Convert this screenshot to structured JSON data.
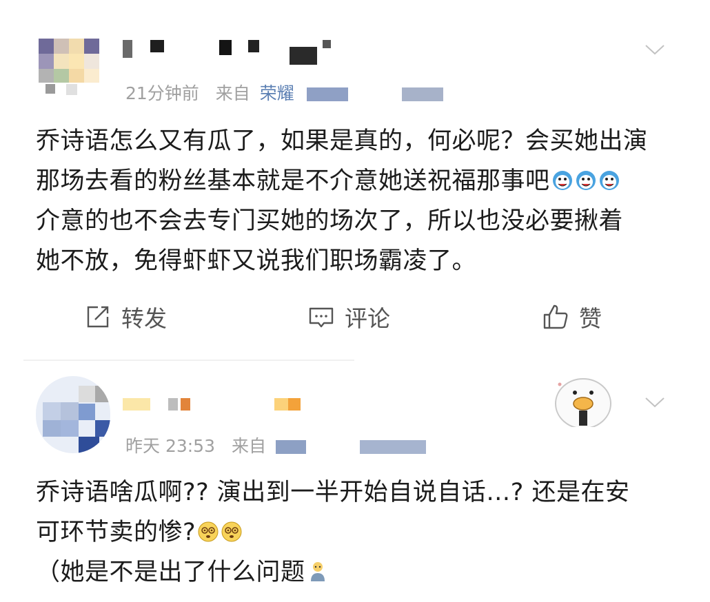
{
  "posts": [
    {
      "time": "21分钟前",
      "source_prefix": "来自",
      "device": "荣耀",
      "lines": [
        "乔诗语怎么又有瓜了，如果是真的，何必呢？会买她出演",
        "那场去看的粉丝基本就是不介意她送祝福那事吧",
        "介意的也不会去专门买她的场次了，所以也没必要揪着",
        "她不放，免得虾虾又说我们职场霸凌了。"
      ],
      "actions": {
        "repost": "转发",
        "comment": "评论",
        "like": "赞"
      }
    },
    {
      "time": "昨天 23:53",
      "source_prefix": "来自",
      "lines": [
        "乔诗语啥瓜啊?? 演出到一半开始自说自话…? 还是在安",
        "可环节卖的惨?",
        "（她是不是出了什么问题"
      ]
    }
  ],
  "icons": {
    "emoji_1": "laughing-tears-emoji",
    "emoji_2": "dizzy-eyes-emoji",
    "emoji_3": "confused-figure-emoji",
    "chevron": "chevron-down-icon",
    "repost": "share-edit-icon",
    "comment": "comment-icon",
    "like": "thumbs-up-icon"
  },
  "colors": {
    "device": "#5b7fb3",
    "meta": "#a0a0a0",
    "action_text": "#555555"
  }
}
